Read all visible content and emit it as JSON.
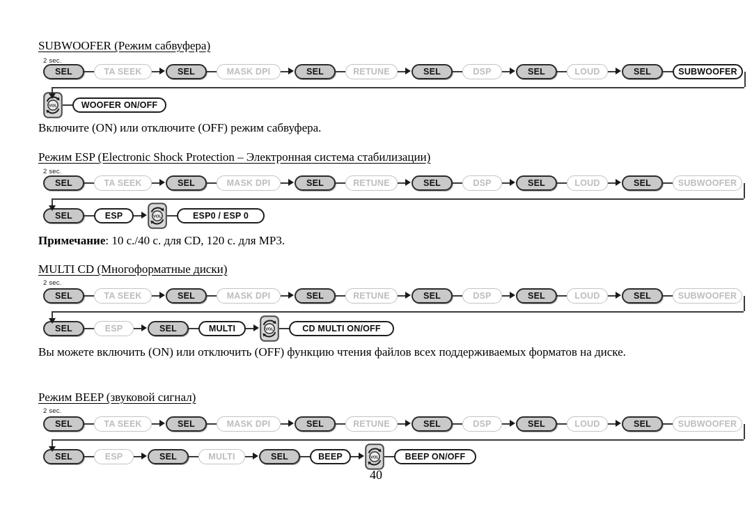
{
  "page": {
    "number": "40"
  },
  "labels": {
    "two_sec": "2 sec.",
    "sel": "SEL",
    "ta_seek": "TA SEEK",
    "mask_dpi": "MASK DPI",
    "retune": "RETUNE",
    "dsp": "DSP",
    "loud": "LOUD",
    "subwoofer": "SUBWOOFER",
    "woofer_onoff": "WOOFER ON/OFF",
    "esp": "ESP",
    "esp_toggle": "ESP0 / ESP 0",
    "multi": "MULTI",
    "cd_multi_onoff": "CD MULTI ON/OFF",
    "beep": "BEEP",
    "beep_onoff": "BEEP ON/OFF",
    "vol": "VOL"
  },
  "colors": {
    "ink": "#000000",
    "pill_sel_fill": "#c9c9c9",
    "pill_sel_border": "#2b2b2b",
    "pill_ghost_border": "#c3c3c3",
    "pill_ghost_text": "#bdbdbd",
    "pill_active_border": "#1d1d1d",
    "connector": "#3a3a3a"
  },
  "sections": [
    {
      "id": "subwoofer",
      "title": "SUBWOOFER (Режим сабвуфера)",
      "chain_row1": [
        {
          "label": "SEL",
          "style": "sel"
        },
        {
          "label": "TA SEEK",
          "style": "ghost"
        },
        {
          "label": "SEL",
          "style": "sel"
        },
        {
          "label": "MASK DPI",
          "style": "ghost"
        },
        {
          "label": "SEL",
          "style": "sel"
        },
        {
          "label": "RETUNE",
          "style": "ghost"
        },
        {
          "label": "SEL",
          "style": "sel"
        },
        {
          "label": "DSP",
          "style": "ghost"
        },
        {
          "label": "SEL",
          "style": "sel"
        },
        {
          "label": "LOUD",
          "style": "ghost"
        },
        {
          "label": "SEL",
          "style": "sel"
        },
        {
          "label": "SUBWOOFER",
          "style": "active"
        }
      ],
      "chain_row2": [
        {
          "label": "VOL",
          "style": "knob"
        },
        {
          "label": "WOOFER ON/OFF",
          "style": "active"
        }
      ],
      "body": "Включите (ON) или отключите (OFF) режим сабвуфера."
    },
    {
      "id": "esp",
      "title": "Режим ESP (Electronic Shock Protection – Электронная система стабилизации)",
      "chain_row1": [
        {
          "label": "SEL",
          "style": "sel"
        },
        {
          "label": "TA SEEK",
          "style": "ghost"
        },
        {
          "label": "SEL",
          "style": "sel"
        },
        {
          "label": "MASK DPI",
          "style": "ghost"
        },
        {
          "label": "SEL",
          "style": "sel"
        },
        {
          "label": "RETUNE",
          "style": "ghost"
        },
        {
          "label": "SEL",
          "style": "sel"
        },
        {
          "label": "DSP",
          "style": "ghost"
        },
        {
          "label": "SEL",
          "style": "sel"
        },
        {
          "label": "LOUD",
          "style": "ghost"
        },
        {
          "label": "SEL",
          "style": "sel"
        },
        {
          "label": "SUBWOOFER",
          "style": "ghost"
        }
      ],
      "chain_row2": [
        {
          "label": "SEL",
          "style": "sel"
        },
        {
          "label": "ESP",
          "style": "active"
        },
        {
          "label": "VOL",
          "style": "knob"
        },
        {
          "label": "ESP0 / ESP 0",
          "style": "active"
        }
      ],
      "body_prefix": "Примечание",
      "body": ": 10 с./40 с. для CD, 120 с. для MP3."
    },
    {
      "id": "multicd",
      "title": "MULTI CD (Многоформатные диски)",
      "chain_row1": [
        {
          "label": "SEL",
          "style": "sel"
        },
        {
          "label": "TA SEEK",
          "style": "ghost"
        },
        {
          "label": "SEL",
          "style": "sel"
        },
        {
          "label": "MASK DPI",
          "style": "ghost"
        },
        {
          "label": "SEL",
          "style": "sel"
        },
        {
          "label": "RETUNE",
          "style": "ghost"
        },
        {
          "label": "SEL",
          "style": "sel"
        },
        {
          "label": "DSP",
          "style": "ghost"
        },
        {
          "label": "SEL",
          "style": "sel"
        },
        {
          "label": "LOUD",
          "style": "ghost"
        },
        {
          "label": "SEL",
          "style": "sel"
        },
        {
          "label": "SUBWOOFER",
          "style": "ghost"
        }
      ],
      "chain_row2": [
        {
          "label": "SEL",
          "style": "sel"
        },
        {
          "label": "ESP",
          "style": "ghost"
        },
        {
          "label": "SEL",
          "style": "sel"
        },
        {
          "label": "MULTI",
          "style": "active"
        },
        {
          "label": "VOL",
          "style": "knob"
        },
        {
          "label": "CD MULTI ON/OFF",
          "style": "active"
        }
      ],
      "body": "Вы можете включить (ON) или отключить (OFF) функцию чтения файлов всех поддерживаемых форматов на диске."
    },
    {
      "id": "beep",
      "title": "Режим BEEP (звуковой сигнал)",
      "chain_row1": [
        {
          "label": "SEL",
          "style": "sel"
        },
        {
          "label": "TA SEEK",
          "style": "ghost"
        },
        {
          "label": "SEL",
          "style": "sel"
        },
        {
          "label": "MASK DPI",
          "style": "ghost"
        },
        {
          "label": "SEL",
          "style": "sel"
        },
        {
          "label": "RETUNE",
          "style": "ghost"
        },
        {
          "label": "SEL",
          "style": "sel"
        },
        {
          "label": "DSP",
          "style": "ghost"
        },
        {
          "label": "SEL",
          "style": "sel"
        },
        {
          "label": "LOUD",
          "style": "ghost"
        },
        {
          "label": "SEL",
          "style": "sel"
        },
        {
          "label": "SUBWOOFER",
          "style": "ghost"
        }
      ],
      "chain_row2": [
        {
          "label": "SEL",
          "style": "sel"
        },
        {
          "label": "ESP",
          "style": "ghost"
        },
        {
          "label": "SEL",
          "style": "sel"
        },
        {
          "label": "MULTI",
          "style": "ghost"
        },
        {
          "label": "SEL",
          "style": "sel"
        },
        {
          "label": "BEEP",
          "style": "active"
        },
        {
          "label": "VOL",
          "style": "knob"
        },
        {
          "label": "BEEP ON/OFF",
          "style": "active"
        }
      ]
    }
  ]
}
